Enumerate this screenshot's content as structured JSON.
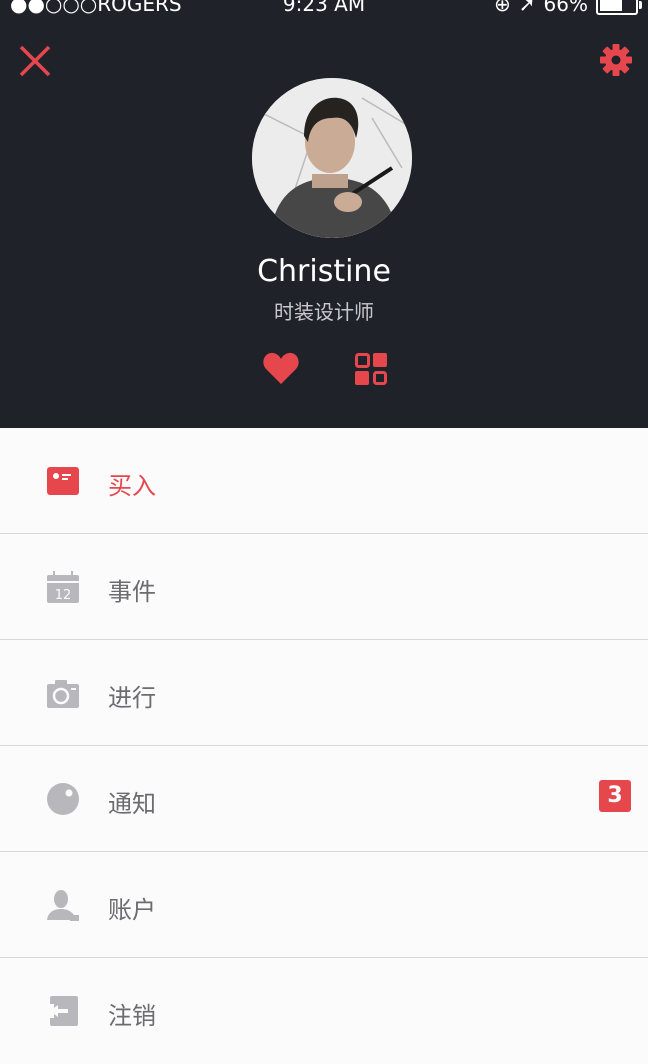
{
  "status_bar": {
    "carrier": "●●○○○ROGERS",
    "time": "9:23 AM",
    "battery": "66%",
    "battery_level": 0.66
  },
  "profile": {
    "name": "Christine",
    "title": "时装设计师"
  },
  "colors": {
    "accent": "#e5474d",
    "header_bg": "#20222a",
    "menu_bg": "#fbfbfc",
    "icon_gray": "#b8b8bc"
  },
  "menu": {
    "items": [
      {
        "label": "买入",
        "icon": "buy-card-icon",
        "active": true
      },
      {
        "label": "事件",
        "icon": "calendar-icon",
        "active": false
      },
      {
        "label": "进行",
        "icon": "camera-icon",
        "active": false
      },
      {
        "label": "通知",
        "icon": "notification-icon",
        "active": false,
        "badge": "3"
      },
      {
        "label": "账户",
        "icon": "account-icon",
        "active": false
      },
      {
        "label": "注销",
        "icon": "logout-icon",
        "active": false
      }
    ]
  },
  "calendar_icon_day": "12"
}
